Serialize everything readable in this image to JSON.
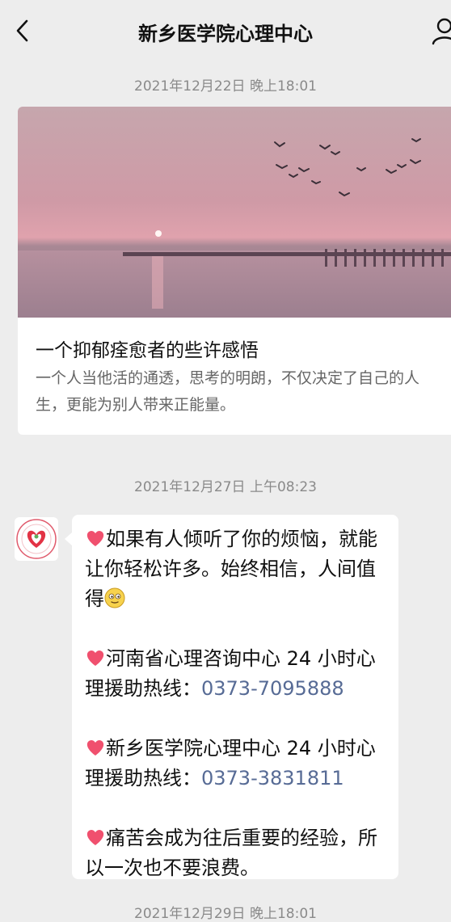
{
  "header": {
    "title": "新乡医学院心理中心"
  },
  "timestamps": [
    "2021年12月22日 晚上18:01",
    "2021年12月27日 上午08:23",
    "2021年12月29日 晚上18:01"
  ],
  "article": {
    "title": "一个抑郁痊愈者的些许感悟",
    "description": "一个人当他活的通透，思考的明朗，不仅决定了自己的人生，更能为别人带来正能量。"
  },
  "message": {
    "p1": "如果有人倾听了你的烦恼，就能让你轻松许多。始终相信，人间值得",
    "p2_text": "河南省心理咨询中心 24 小时心理援助热线：",
    "p2_phone": "0373-7095888",
    "p3_text": "新乡医学院心理中心 24 小时心理援助热线：",
    "p3_phone": "0373-3831811",
    "p4": "痛苦会成为往后重要的经验，所以一次也不要浪费。"
  },
  "colors": {
    "background": "#ededed",
    "link": "#576b95",
    "heart": "#f0506e"
  },
  "icons": [
    "back-arrow-icon",
    "profile-icon",
    "heart-icon",
    "smile-emoji-icon"
  ]
}
